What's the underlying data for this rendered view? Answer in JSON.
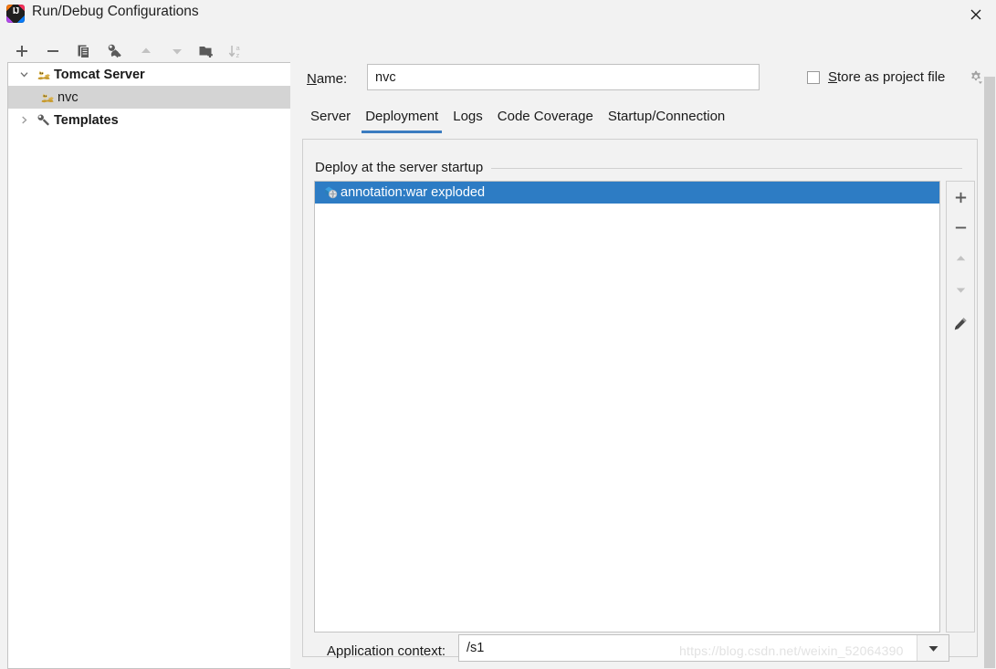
{
  "window": {
    "title": "Run/Debug Configurations",
    "app_icon": "intellij-idea-logo",
    "close_icon": "close-icon"
  },
  "left_toolbar": {
    "buttons": [
      {
        "name": "add-configuration-button",
        "icon": "plus-icon",
        "enabled": true
      },
      {
        "name": "remove-configuration-button",
        "icon": "minus-icon",
        "enabled": true
      },
      {
        "name": "copy-configuration-button",
        "icon": "copy-icon",
        "enabled": true
      },
      {
        "name": "edit-templates-button",
        "icon": "wrench-icon",
        "enabled": true
      },
      {
        "name": "move-up-button",
        "icon": "arrow-up-icon",
        "enabled": false
      },
      {
        "name": "move-down-button",
        "icon": "arrow-down-icon",
        "enabled": false
      },
      {
        "name": "new-folder-button",
        "icon": "folder-add-icon",
        "enabled": true
      },
      {
        "name": "sort-alphabetically-button",
        "icon": "sort-az-icon",
        "enabled": false
      }
    ]
  },
  "tree": {
    "items": [
      {
        "label": "Tomcat Server",
        "icon": "tomcat-icon",
        "chevron": "chevron-down-icon",
        "expanded": true,
        "bold": true,
        "selected": false,
        "indent": 0
      },
      {
        "label": "nvc",
        "icon": "tomcat-icon",
        "chevron": "",
        "expanded": false,
        "bold": false,
        "selected": true,
        "indent": 1
      },
      {
        "label": "Templates",
        "icon": "wrench-icon",
        "chevron": "chevron-right-icon",
        "expanded": false,
        "bold": true,
        "selected": false,
        "indent": 0
      }
    ]
  },
  "form": {
    "name_label_mnemonic": "N",
    "name_label_rest": "ame:",
    "name_value": "nvc",
    "store_as_project_file": {
      "checked": false,
      "mnemonic": "S",
      "label_rest": "tore as project file",
      "gear_icon": "gear-dropdown-icon"
    }
  },
  "tabs": {
    "items": [
      {
        "label": "Server",
        "active": false
      },
      {
        "label": "Deployment",
        "active": true
      },
      {
        "label": "Logs",
        "active": false
      },
      {
        "label": "Code Coverage",
        "active": false
      },
      {
        "label": "Startup/Connection",
        "active": false
      }
    ],
    "active_underline_color": "#3b7cc0"
  },
  "deployment": {
    "group_title": "Deploy at the server startup",
    "artifacts": [
      {
        "label": "annotation:war exploded",
        "icon": "artifact-war-icon",
        "selected": true
      }
    ],
    "selection_color": "#2d7cc4",
    "side_toolbar": [
      {
        "name": "add-artifact-button",
        "icon": "plus-icon",
        "enabled": true
      },
      {
        "name": "remove-artifact-button",
        "icon": "minus-icon",
        "enabled": true
      },
      {
        "name": "move-artifact-up-button",
        "icon": "arrow-up-icon",
        "enabled": false
      },
      {
        "name": "move-artifact-down-button",
        "icon": "arrow-down-icon",
        "enabled": false
      },
      {
        "name": "edit-artifact-button",
        "icon": "pencil-icon",
        "enabled": true
      }
    ],
    "application_context": {
      "label": "Application context:",
      "value": "/s1",
      "placeholder": "",
      "dropdown_icon": "chevron-down-icon"
    }
  },
  "watermark": {
    "text": "https://blog.csdn.net/weixin_52064390"
  }
}
